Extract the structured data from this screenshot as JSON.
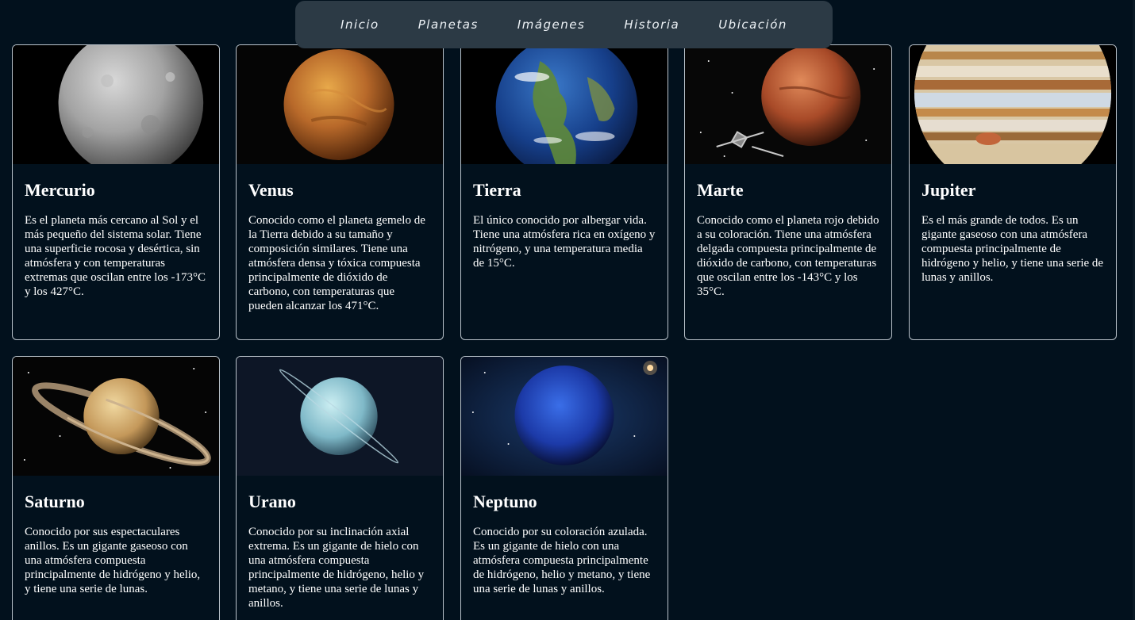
{
  "nav": {
    "items": [
      {
        "label": "Inicio"
      },
      {
        "label": "Planetas"
      },
      {
        "label": "Imágenes"
      },
      {
        "label": "Historia"
      },
      {
        "label": "Ubicación"
      }
    ]
  },
  "planets": [
    {
      "name": "Mercurio",
      "description": "Es el planeta más cercano al Sol y el más pequeño del sistema solar. Tiene una superficie rocosa y desértica, sin atmósfera y con temperaturas extremas que oscilan entre los -173°C y los 427°C."
    },
    {
      "name": "Venus",
      "description": "Conocido como el planeta gemelo de la Tierra debido a su tamaño y composición similares. Tiene una atmósfera densa y tóxica compuesta principalmente de dióxido de carbono, con temperaturas que pueden alcanzar los 471°C."
    },
    {
      "name": "Tierra",
      "description": "El único conocido por albergar vida. Tiene una atmósfera rica en oxígeno y nitrógeno, y una temperatura media de 15°C."
    },
    {
      "name": "Marte",
      "description": "Conocido como el planeta rojo debido a su coloración. Tiene una atmósfera delgada compuesta principalmente de dióxido de carbono, con temperaturas que oscilan entre los -143°C y los 35°C."
    },
    {
      "name": "Jupiter",
      "description": "Es el más grande de todos. Es un gigante gaseoso con una atmósfera compuesta principalmente de hidrógeno y helio, y tiene una serie de lunas y anillos."
    },
    {
      "name": "Saturno",
      "description": "Conocido por sus espectaculares anillos. Es un gigante gaseoso con una atmósfera compuesta principalmente de hidrógeno y helio, y tiene una serie de lunas."
    },
    {
      "name": "Urano",
      "description": "Conocido por su inclinación axial extrema. Es un gigante de hielo con una atmósfera compuesta principalmente de hidrógeno, helio y metano, y tiene una serie de lunas y anillos."
    },
    {
      "name": "Neptuno",
      "description": "Conocido por su coloración azulada. Es un gigante de hielo con una atmósfera compuesta principalmente de hidrógeno, helio y metano, y tiene una serie de lunas y anillos."
    }
  ],
  "colors": {
    "background": "#02111d",
    "nav_background": "#2c3a45",
    "card_border": "#b9c2ca",
    "text": "#ffffff"
  }
}
